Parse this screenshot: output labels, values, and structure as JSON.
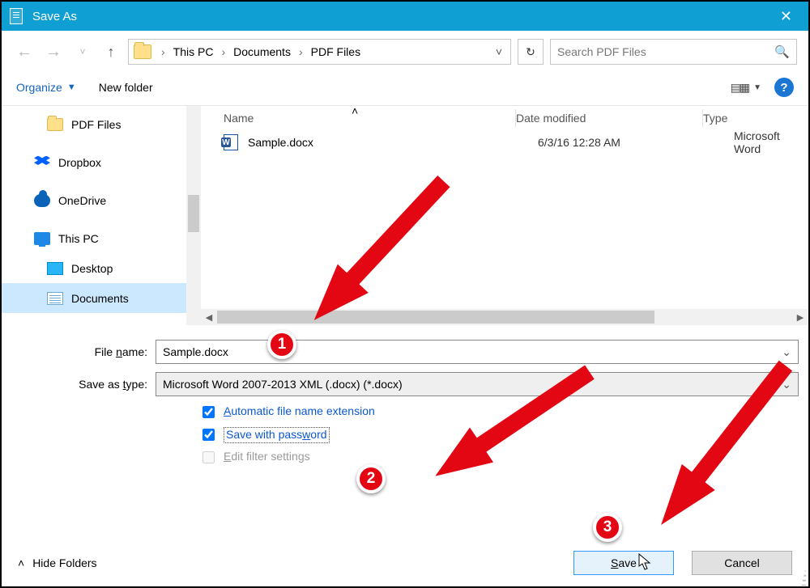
{
  "window": {
    "title": "Save As"
  },
  "nav": {
    "crumbs": [
      "This PC",
      "Documents",
      "PDF Files"
    ],
    "search_placeholder": "Search PDF Files"
  },
  "toolbar": {
    "organize": "Organize",
    "new_folder": "New folder"
  },
  "tree": {
    "items": [
      {
        "label": "PDF Files",
        "icon": "folder"
      },
      {
        "label": "Dropbox",
        "icon": "dropbox"
      },
      {
        "label": "OneDrive",
        "icon": "cloud"
      },
      {
        "label": "This PC",
        "icon": "pc"
      },
      {
        "label": "Desktop",
        "icon": "desktop"
      },
      {
        "label": "Documents",
        "icon": "docs",
        "selected": true
      }
    ]
  },
  "columns": {
    "name": "Name",
    "date": "Date modified",
    "type": "Type"
  },
  "files": [
    {
      "name": "Sample.docx",
      "date": "6/3/16 12:28 AM",
      "type": "Microsoft Word"
    }
  ],
  "form": {
    "file_name_label": "File name:",
    "file_name_value": "Sample.docx",
    "save_type_label": "Save as type:",
    "save_type_value": "Microsoft Word 2007-2013 XML (.docx) (*.docx)",
    "checks": {
      "auto_ext": "Automatic file name extension",
      "save_pw": "Save with password",
      "edit_filter": "Edit filter settings"
    }
  },
  "bottom": {
    "hide_folders": "Hide Folders",
    "save": "Save",
    "cancel": "Cancel"
  },
  "annotations": {
    "b1": "1",
    "b2": "2",
    "b3": "3"
  }
}
